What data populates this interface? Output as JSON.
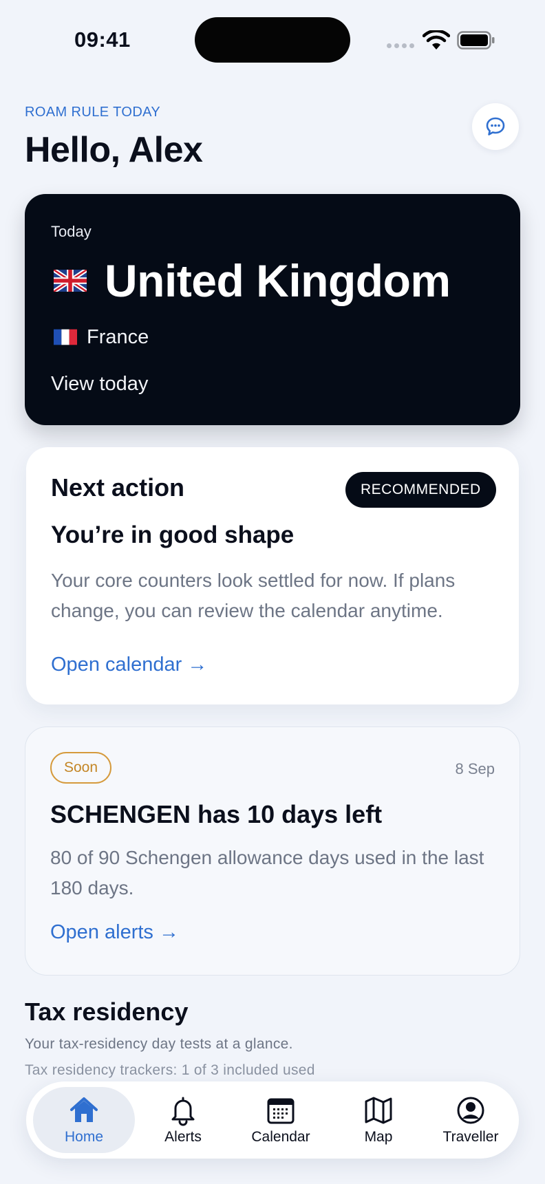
{
  "status_bar": {
    "time": "09:41"
  },
  "header": {
    "eyebrow": "ROAM RULE TODAY",
    "greeting": "Hello, Alex",
    "chat_icon": "chat-bubble-icon"
  },
  "today_card": {
    "label": "Today",
    "country": "United Kingdom",
    "country_flag": "uk-flag-icon",
    "secondary_country": "France",
    "secondary_flag": "france-flag-icon",
    "link": "View today"
  },
  "next_action": {
    "title": "Next action",
    "badge": "RECOMMENDED",
    "heading": "You’re in good shape",
    "body": "Your core counters look settled for now. If plans change, you can review the calendar anytime.",
    "link": "Open calendar →"
  },
  "alert": {
    "badge": "Soon",
    "date": "8 Sep",
    "heading": "SCHENGEN has 10 days left",
    "body": "80 of 90 Schengen allowance days used in the last 180 days.",
    "link": "Open alerts →"
  },
  "tax": {
    "title": "Tax residency",
    "subtitle": "Your tax-residency day tests at a glance.",
    "tracker": "Tax residency trackers: 1 of 3 included used"
  },
  "nav": {
    "active": "Home",
    "items": [
      {
        "label": "Home",
        "icon": "home-icon"
      },
      {
        "label": "Alerts",
        "icon": "bell-icon"
      },
      {
        "label": "Calendar",
        "icon": "calendar-icon"
      },
      {
        "label": "Map",
        "icon": "map-icon"
      },
      {
        "label": "Traveller",
        "icon": "user-icon"
      }
    ]
  },
  "colors": {
    "accent": "#2f6fd0",
    "dark_card": "#050b16",
    "warning": "#d59a3c",
    "background": "#f1f4fa"
  }
}
